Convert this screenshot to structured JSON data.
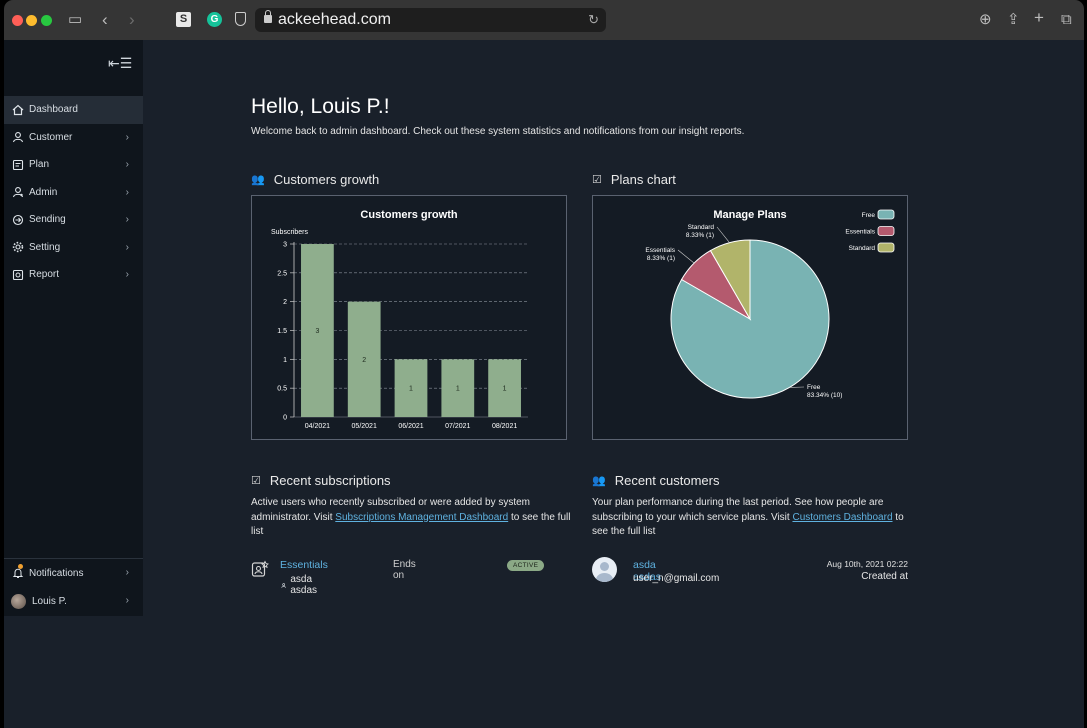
{
  "browser": {
    "url": "ackeehead.com"
  },
  "sidebar": {
    "items": [
      {
        "label": "Dashboard",
        "icon": "home-icon",
        "active": true
      },
      {
        "label": "Customer",
        "icon": "user-icon"
      },
      {
        "label": "Plan",
        "icon": "plan-icon"
      },
      {
        "label": "Admin",
        "icon": "admin-icon"
      },
      {
        "label": "Sending",
        "icon": "sending-icon"
      },
      {
        "label": "Setting",
        "icon": "gear-icon"
      },
      {
        "label": "Report",
        "icon": "report-icon"
      }
    ],
    "notifications_label": "Notifications",
    "user_label": "Louis P."
  },
  "header": {
    "greeting": "Hello, Louis P.!",
    "welcome": "Welcome back to admin dashboard. Check out these system statistics and notifications from our insight reports."
  },
  "growth_section": {
    "title": "Customers growth"
  },
  "plans_section": {
    "title": "Plans chart"
  },
  "chart_data": [
    {
      "type": "bar",
      "title": "Customers growth",
      "ylabel": "Subscribers",
      "categories": [
        "04/2021",
        "05/2021",
        "06/2021",
        "07/2021",
        "08/2021"
      ],
      "values": [
        3,
        2,
        1,
        1,
        1
      ],
      "data_labels": [
        "3",
        "2",
        "1",
        "1",
        "1"
      ],
      "yticks": [
        "0",
        "0.5",
        "1",
        "1.5",
        "2",
        "2.5",
        "3"
      ],
      "ylim": [
        0,
        3
      ],
      "grid": true,
      "bar_color": "#8fae8d"
    },
    {
      "type": "pie",
      "title": "Manage Plans",
      "legend_position": "top-right",
      "slices": [
        {
          "name": "Free",
          "value": 10,
          "percent": 83.34,
          "label": "83.34% (10)",
          "color": "#79b3b3"
        },
        {
          "name": "Essentials",
          "value": 1,
          "percent": 8.33,
          "label": "8.33% (1)",
          "color": "#b45a6e"
        },
        {
          "name": "Standard",
          "value": 1,
          "percent": 8.33,
          "label": "8.33% (1)",
          "color": "#b1b46a"
        }
      ]
    }
  ],
  "recent_subscriptions": {
    "title": "Recent subscriptions",
    "desc_before": "Active users who recently subscribed or were added by system administrator. Visit ",
    "link": "Subscriptions Management Dashboard",
    "desc_after": " to see the full list",
    "item": {
      "plan": "Essentials",
      "user": "asda asdas",
      "ends_label": "Ends on",
      "status": "ACTIVE"
    }
  },
  "recent_customers": {
    "title": "Recent customers",
    "desc_before": "Your plan performance during the last period. See how people are subscribing to your which service plans. Visit ",
    "link": "Customers Dashboard",
    "desc_after": " to see the full list",
    "item": {
      "name": "asda asdas",
      "email": "user_n@gmail.com",
      "date": "Aug 10th, 2021 02:22",
      "date_label": "Created at"
    }
  }
}
